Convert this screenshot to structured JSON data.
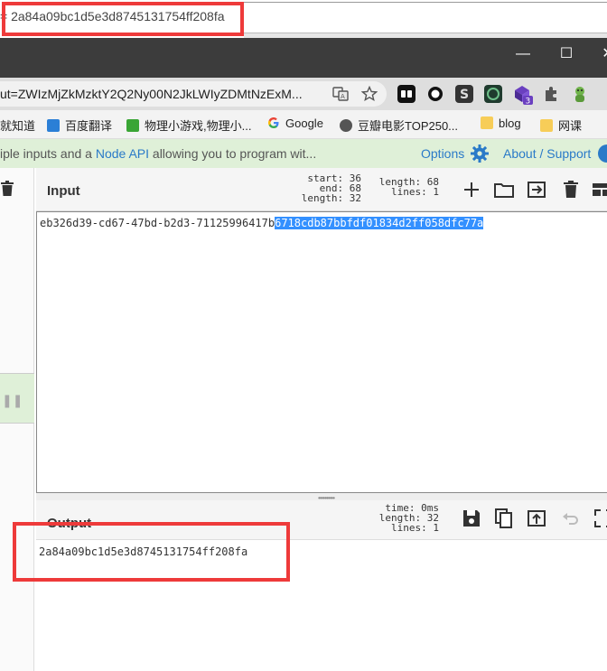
{
  "prev_window": {
    "title": "= 2a84a09bc1d5e3d8745131754ff208fa"
  },
  "window_controls": {
    "minimize": "—",
    "maximize": "☐",
    "close": "✕"
  },
  "address_bar": {
    "url": "ut=ZWIzMjZkMzktY2Q2Ny00N2JkLWIyZDMtNzExM..."
  },
  "extensions": {
    "badge_count": "3"
  },
  "bookmarks": [
    {
      "label": "就知道",
      "icon": "folder"
    },
    {
      "label": "百度翻译",
      "icon": "translate-icon"
    },
    {
      "label": "物理小游戏,物理小...",
      "icon": "grid-icon"
    },
    {
      "label": "Google",
      "icon": "google-icon"
    },
    {
      "label": "豆瓣电影TOP250...",
      "icon": "globe-icon"
    },
    {
      "label": "blog",
      "icon": "folder"
    },
    {
      "label": "网课",
      "icon": "folder"
    }
  ],
  "banner": {
    "text_before": "iple inputs and a ",
    "link_text": "Node API",
    "text_after": " allowing you to program wit...",
    "options_label": "Options",
    "about_label": "About / Support"
  },
  "input_pane": {
    "title": "Input",
    "stats_left": {
      "start_label": "start:",
      "start": "36",
      "end_label": "end:",
      "end": "68",
      "length_label": "length:",
      "length": "32"
    },
    "stats_right": {
      "length_label": "length:",
      "length": "68",
      "lines_label": "lines:",
      "lines": "1"
    },
    "text_plain": "eb326d39-cd67-47bd-b2d3-71125996417b",
    "text_selected": "6718cdb87bbfdf01834d2ff058dfc77a"
  },
  "output_pane": {
    "title": "Output",
    "stats": {
      "time_label": "time:",
      "time": "0ms",
      "length_label": "length:",
      "length": "32",
      "lines_label": "lines:",
      "lines": "1"
    },
    "text": "2a84a09bc1d5e3d8745131754ff208fa"
  },
  "colors": {
    "highlight_red": "#ee3a3a",
    "selection_blue": "#3390ff",
    "banner_green": "#dff0d8",
    "link_blue": "#2a7ac8",
    "chrome_dark": "#3c3c3c"
  }
}
